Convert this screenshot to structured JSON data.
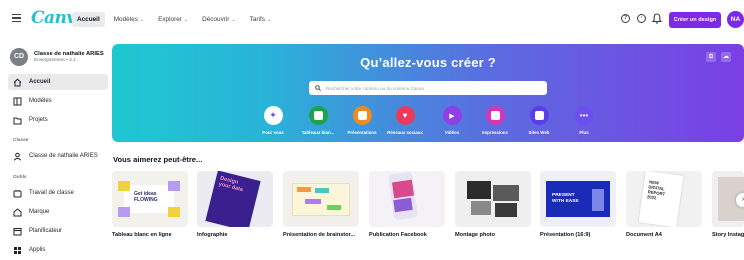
{
  "header": {
    "logo": "Canva",
    "nav": [
      {
        "label": "Accueil",
        "active": true,
        "chevron": false
      },
      {
        "label": "Modèles",
        "active": false,
        "chevron": true
      },
      {
        "label": "Explorer",
        "active": false,
        "chevron": true
      },
      {
        "label": "Découvrir",
        "active": false,
        "chevron": true
      },
      {
        "label": "Tarifs",
        "active": false,
        "chevron": true
      }
    ],
    "create_button": "Créer un design",
    "avatar_initials": "NA"
  },
  "sidebar": {
    "team_initials": "CD",
    "team_name": "Classe de nathalie ARIES",
    "team_sub": "Enseignement • 3.1",
    "items_top": [
      "Accueil",
      "Modèles",
      "Projets"
    ],
    "section_class": "Classe",
    "class_item": "Classe de nathalie ARIES",
    "section_tools": "Outils",
    "tools": [
      "Travail de classe",
      "Marque",
      "Planificateur",
      "Applis"
    ]
  },
  "hero": {
    "title": "Qu’allez-vous créer ?",
    "search_placeholder": "Rechercher votre contenu ou du contenu Canva",
    "categories": [
      {
        "label": "Pour vous",
        "color": "#ffffff",
        "icon": "sparkle-icon"
      },
      {
        "label": "Tableaux blan...",
        "color": "#1fa34a",
        "icon": "whiteboard-icon"
      },
      {
        "label": "Présentations",
        "color": "#f08a1c",
        "icon": "presentation-icon"
      },
      {
        "label": "Réseaux sociaux",
        "color": "#ea3b5b",
        "icon": "heart-icon"
      },
      {
        "label": "Vidéos",
        "color": "#8f3ee8",
        "icon": "video-icon"
      },
      {
        "label": "Impressions",
        "color": "#d834b8",
        "icon": "print-icon"
      },
      {
        "label": "Sites Web",
        "color": "#5a3ee8",
        "icon": "website-icon"
      },
      {
        "label": "Plus",
        "color": "#6b4ff0",
        "icon": "more-icon"
      }
    ]
  },
  "suggestions": {
    "title": "Vous aimerez peut-être...",
    "cards": [
      {
        "label": "Tableau blanc en ligne"
      },
      {
        "label": "Infographie"
      },
      {
        "label": "Présentation de brainstor..."
      },
      {
        "label": "Publication Facebook"
      },
      {
        "label": "Montage photo"
      },
      {
        "label": "Présentation (16:9)"
      },
      {
        "label": "Document A4"
      },
      {
        "label": "Story Instag"
      }
    ],
    "thumb_text": {
      "whiteboard": "Get ideas FLOWING",
      "infographic": "Design your data",
      "presentation": "PRESENT WITH EASE",
      "document": "NEW DIGITAL REPORT 2022"
    }
  }
}
